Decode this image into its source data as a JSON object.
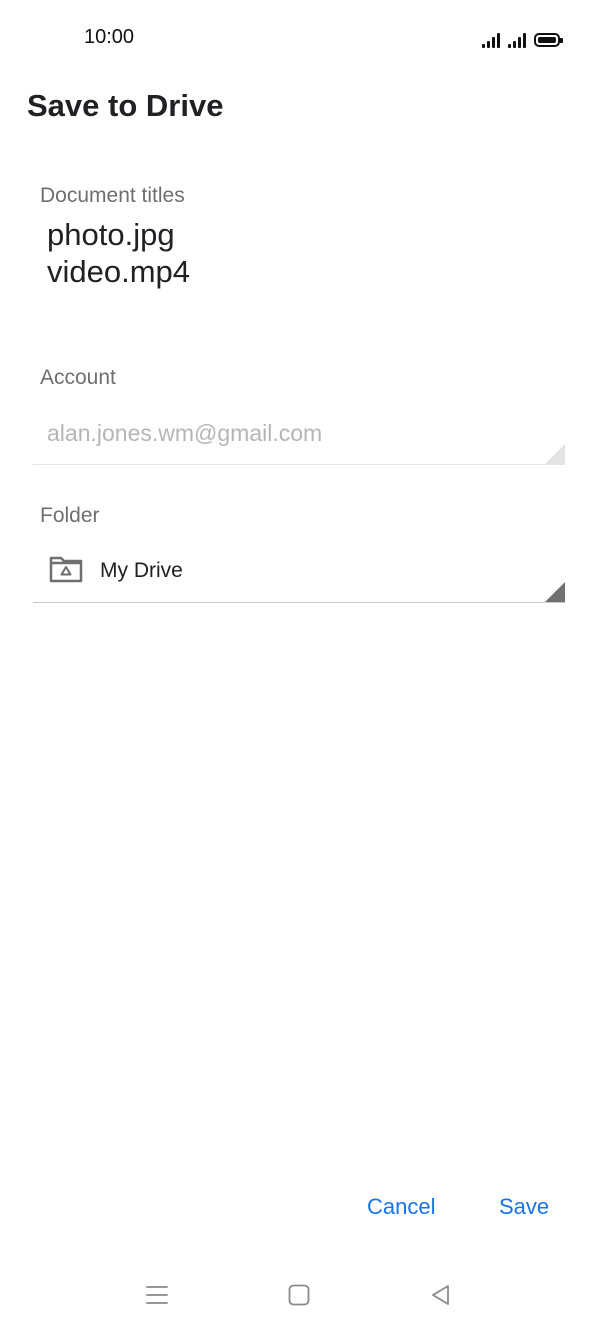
{
  "status_bar": {
    "time": "10:00"
  },
  "page": {
    "title": "Save to Drive"
  },
  "document_titles": {
    "label": "Document titles",
    "items": [
      "photo.jpg",
      "video.mp4"
    ]
  },
  "account": {
    "label": "Account",
    "value": "alan.jones.wm@gmail.com"
  },
  "folder": {
    "label": "Folder",
    "value": "My Drive",
    "icon": "drive-folder-icon"
  },
  "actions": {
    "cancel_label": "Cancel",
    "save_label": "Save"
  },
  "nav_bar": {
    "icons": [
      "menu-icon",
      "home-icon",
      "back-icon"
    ]
  },
  "colors": {
    "accent": "#1a73e8",
    "text": "#202124",
    "label": "#6f6f6f",
    "disabled": "#b5b5b5"
  }
}
